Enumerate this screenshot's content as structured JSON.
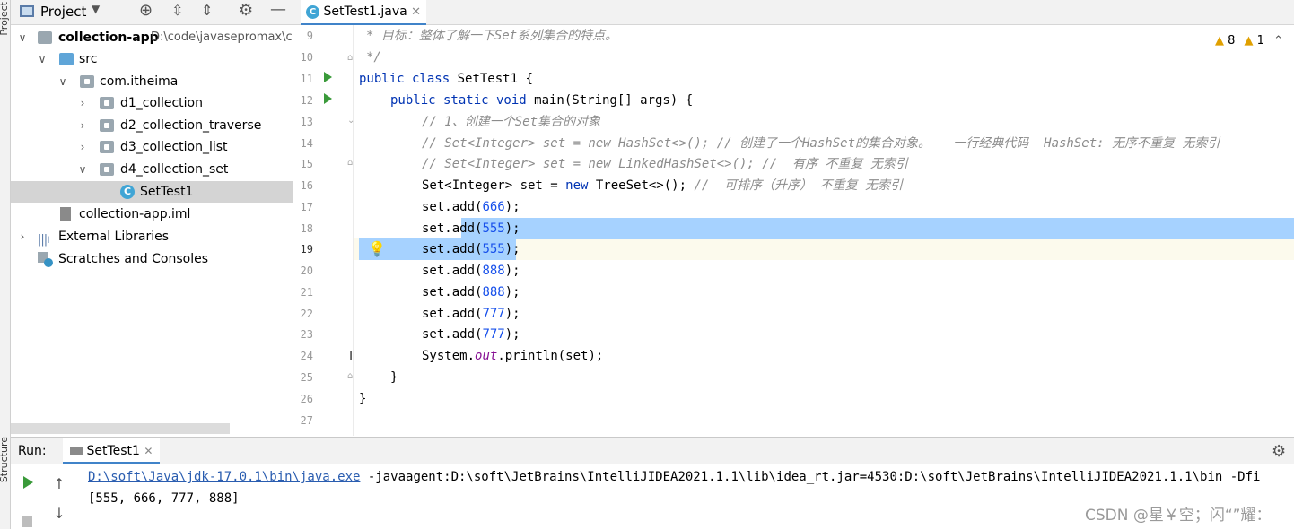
{
  "left_strip": {
    "top_label": "Project",
    "bottom_label": "Structure"
  },
  "project_panel": {
    "title": "Project",
    "tree": [
      {
        "label": "collection-app",
        "path": "D:\\code\\javasepromax\\c",
        "icon": "module-folder-icon"
      },
      {
        "label": "src",
        "icon": "source-folder-icon"
      },
      {
        "label": "com.itheima",
        "icon": "package-icon"
      },
      {
        "label": "d1_collection",
        "icon": "package-icon"
      },
      {
        "label": "d2_collection_traverse",
        "icon": "package-icon"
      },
      {
        "label": "d3_collection_list",
        "icon": "package-icon"
      },
      {
        "label": "d4_collection_set",
        "icon": "package-icon"
      },
      {
        "label": "SetTest1",
        "icon": "java-class-icon"
      },
      {
        "label": "collection-app.iml",
        "icon": "iml-file-icon"
      },
      {
        "label": "External Libraries",
        "icon": "libraries-icon"
      },
      {
        "label": "Scratches and Consoles",
        "icon": "scratches-icon"
      }
    ]
  },
  "editor": {
    "tab_label": "SetTest1.java",
    "class_letter": "C",
    "inspections": {
      "warnings": "8",
      "weak_warnings": "1"
    },
    "line_numbers": [
      "9",
      "10",
      "11",
      "12",
      "13",
      "14",
      "15",
      "16",
      "17",
      "18",
      "19",
      "20",
      "21",
      "22",
      "23",
      "24",
      "25",
      "26",
      "27"
    ],
    "code": {
      "l9": "* 目标：整体了解一下Set系列集合的特点。",
      "l10": "*/",
      "l11_kw": "public class",
      "l11_rest": " SetTest1 {",
      "l12_kw": "public static void",
      "l12_rest": " main(String[] args) {",
      "l13": "// 1、创建一个Set集合的对象",
      "l14": "// Set<Integer> set = new HashSet<>(); // 创建了一个HashSet的集合对象。   一行经典代码  HashSet: 无序不重复 无索引",
      "l15": "// Set<Integer> set = new LinkedHashSet<>(); //  有序 不重复 无索引",
      "l16_a": "Set<Integer> set = ",
      "l16_kw": "new",
      "l16_b": " TreeSet<>(); ",
      "l16_cm": "//  可排序（升序） 不重复 无索引",
      "adds": [
        "666",
        "555",
        "555",
        "888",
        "888",
        "777",
        "777"
      ],
      "add_prefix": "set.add(",
      "add_suffix": ");",
      "l24_a": "System.",
      "l24_field": "out",
      "l24_b": ".println(set);",
      "l25": "}",
      "l26": "}"
    }
  },
  "run_panel": {
    "label": "Run:",
    "tab_label": "SetTest1",
    "command_link": "D:\\soft\\Java\\jdk-17.0.1\\bin\\java.exe",
    "command_rest": " -javaagent:D:\\soft\\JetBrains\\IntelliJIDEA2021.1.1\\lib\\idea_rt.jar=4530:D:\\soft\\JetBrains\\IntelliJIDEA2021.1.1\\bin -Dfi",
    "output": "[555, 666, 777, 888]"
  },
  "watermark": "CSDN @星￥空；闪“”耀："
}
